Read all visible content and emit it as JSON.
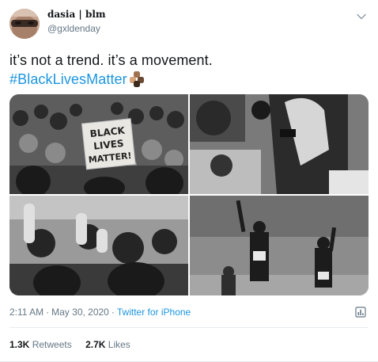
{
  "user": {
    "display_name": "dasia | blm",
    "handle": "@gxldenday",
    "avatar_icon": "profile-photo"
  },
  "tweet": {
    "line1": "it’s not a trend. it’s a movement.",
    "hashtag": "#BlackLivesMatter",
    "emoji_icon": "raised-fists-emoji",
    "photo_sign_text": "BLACK LIVES MATTER!"
  },
  "meta": {
    "time": "2:11 AM",
    "separator": "·",
    "date": "May 30, 2020",
    "source": "Twitter for iPhone"
  },
  "stats": {
    "retweets_count": "1.3K",
    "retweets_label": "Retweets",
    "likes_count": "2.7K",
    "likes_label": "Likes"
  },
  "colors": {
    "link": "#1b95e0",
    "secondary_text": "#657786",
    "primary_text": "#14171a",
    "divider": "#e6ecf0"
  }
}
